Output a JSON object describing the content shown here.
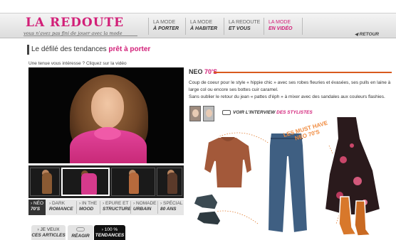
{
  "header": {
    "logo": "LA REDOUTE",
    "tagline": "vous n'avez pas fini de jouer avec la mode",
    "nav": [
      {
        "l1": "LA MODE",
        "l2": "À PORTER",
        "active": false
      },
      {
        "l1": "LA MODE",
        "l2": "À HABITER",
        "active": false
      },
      {
        "l1": "LA REDOUTE",
        "l2": "ET VOUS",
        "active": false
      },
      {
        "l1": "LA MODE",
        "l2": "EN VIDÉO",
        "active": true
      }
    ],
    "retour": "RETOUR"
  },
  "main": {
    "title_prefix": "Le défilé des tendances",
    "title_accent": "prêt à porter",
    "subhead": "Une tenue vous intéresse ? Cliquez sur la vidéo"
  },
  "categories": [
    {
      "c1": "NÉO",
      "c2": "70'S",
      "selected": true
    },
    {
      "c1": "DARK",
      "c2": "ROMANCE",
      "selected": false
    },
    {
      "c1": "IN THE",
      "c2": "MOOD",
      "selected": false
    },
    {
      "c1": "EPURE ET",
      "c2": "STRUCTURE",
      "selected": false
    },
    {
      "c1": "NOMADE",
      "c2": "URBAIN",
      "selected": false
    },
    {
      "c1": "SPÉCIAL",
      "c2": "80 ANS",
      "selected": false
    }
  ],
  "bottom_buttons": [
    {
      "l1": "JE VEUX",
      "l2": "CES ARTICLES"
    },
    {
      "l1": "",
      "l2": "RÉAGIR"
    },
    {
      "l1": "100 %",
      "l2": "TENDANCES"
    }
  ],
  "detail": {
    "title_prefix": "NEO",
    "title_accent": "70'S",
    "description": [
      "Coup de coeur pour le style « hippie chic » avec ses robes fleuries et évasées, ses pulls en laine à large col ou encore ses bottes cuir caramel.",
      "Sans oublier le retour du jean « pattes d'éph » à mixer avec des sandales aux couleurs flashies."
    ],
    "interview_prefix": "VOIR L'INTERVIEW",
    "interview_accent": "DES STYLISTES",
    "must_have_l1": "LES MUST HAVE",
    "must_have_l2": "NEO 70'S"
  },
  "colors": {
    "accent": "#d21f78",
    "orange": "#d85a1e"
  }
}
